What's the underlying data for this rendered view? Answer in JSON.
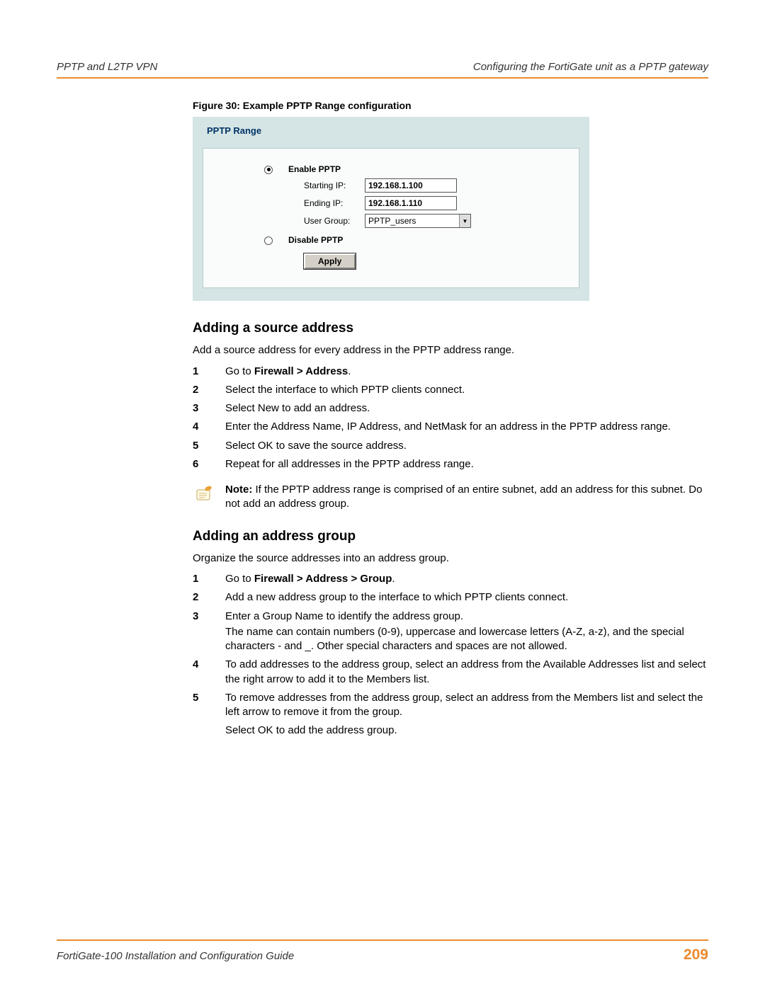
{
  "header": {
    "left": "PPTP and L2TP VPN",
    "right": "Configuring the FortiGate unit as a PPTP gateway"
  },
  "figure": {
    "caption": "Figure 30: Example PPTP Range configuration",
    "tab_label": "PPTP Range",
    "enable_label": "Enable PPTP",
    "starting_ip_label": "Starting IP:",
    "starting_ip_value": "192.168.1.100",
    "ending_ip_label": "Ending IP:",
    "ending_ip_value": "192.168.1.110",
    "user_group_label": "User Group:",
    "user_group_value": "PPTP_users",
    "disable_label": "Disable PPTP",
    "apply_label": "Apply"
  },
  "section1": {
    "title": "Adding a source address",
    "intro": "Add a source address for every address in the PPTP address range.",
    "steps": [
      {
        "num": "1",
        "prefix": "Go to ",
        "bold": "Firewall > Address",
        "suffix": "."
      },
      {
        "num": "2",
        "text": "Select the interface to which PPTP clients connect."
      },
      {
        "num": "3",
        "text": "Select New to add an address."
      },
      {
        "num": "4",
        "text": "Enter the Address Name, IP Address, and NetMask for an address in the PPTP address range."
      },
      {
        "num": "5",
        "text": "Select OK to save the source address."
      },
      {
        "num": "6",
        "text": "Repeat for all addresses in the PPTP address range."
      }
    ]
  },
  "note": {
    "label": "Note:",
    "text": " If the PPTP address range is comprised of an entire subnet, add an address for this subnet. Do not add an address group."
  },
  "section2": {
    "title": "Adding an address group",
    "intro": "Organize the source addresses into an address group.",
    "steps": [
      {
        "num": "1",
        "prefix": "Go to ",
        "bold": "Firewall > Address > Group",
        "suffix": "."
      },
      {
        "num": "2",
        "text": "Add a new address group to the interface to which PPTP clients connect."
      },
      {
        "num": "3",
        "text": "Enter a Group Name to identify the address group.",
        "extra": "The name can contain numbers (0-9), uppercase and lowercase letters (A-Z, a-z), and the special characters - and _. Other special characters and spaces are not allowed."
      },
      {
        "num": "4",
        "text": "To add addresses to the address group, select an address from the Available Addresses list and select the right arrow to add it to the Members list."
      },
      {
        "num": "5",
        "text": "To remove addresses from the address group, select an address from the Members list and select the left arrow to remove it from the group.",
        "trail": "Select OK to add the address group."
      }
    ]
  },
  "footer": {
    "left": "FortiGate-100 Installation and Configuration Guide",
    "page": "209"
  }
}
